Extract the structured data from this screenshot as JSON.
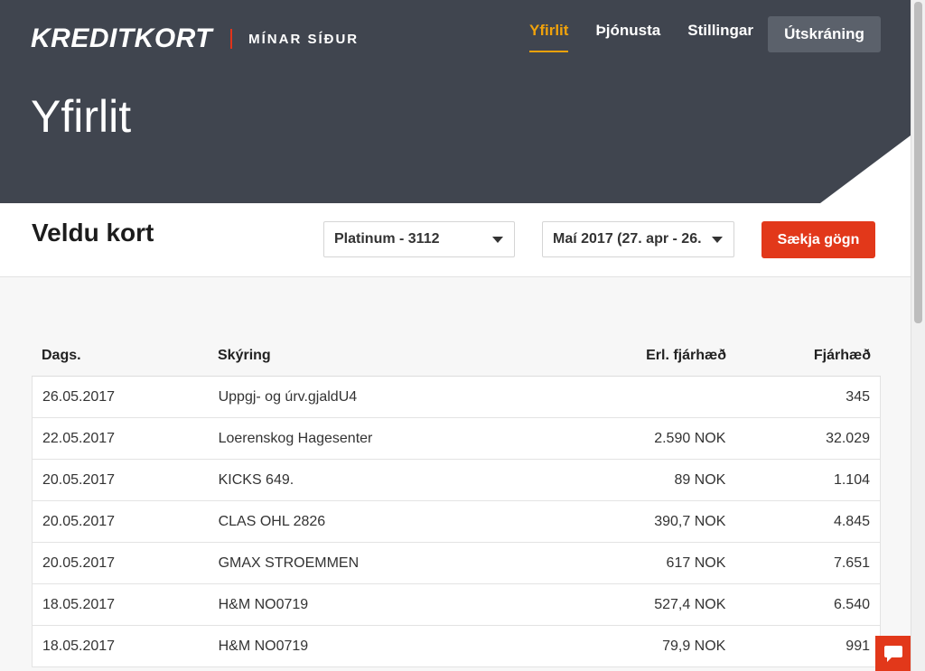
{
  "header": {
    "logo_text": "KREDITKORT",
    "logo_subtitle": "MÍNAR SÍÐUR",
    "nav": [
      {
        "label": "Yfirlit",
        "active": true
      },
      {
        "label": "Þjónusta",
        "active": false
      },
      {
        "label": "Stillingar",
        "active": false
      }
    ],
    "logout_label": "Útskráning",
    "page_title": "Yfirlit"
  },
  "filter": {
    "title": "Veldu kort",
    "card_select": "Platinum - 3112",
    "period_select": "Maí 2017 (27. apr - 26.",
    "fetch_label": "Sækja gögn"
  },
  "table": {
    "headers": {
      "date": "Dags.",
      "description": "Skýring",
      "foreign_amount": "Erl. fjárhæð",
      "amount": "Fjárhæð"
    },
    "rows": [
      {
        "date": "26.05.2017",
        "description": "Uppgj- og úrv.gjaldU4",
        "foreign_amount": "",
        "amount": "345"
      },
      {
        "date": "22.05.2017",
        "description": "Loerenskog Hagesenter",
        "foreign_amount": "2.590 NOK",
        "amount": "32.029"
      },
      {
        "date": "20.05.2017",
        "description": "KICKS 649.",
        "foreign_amount": "89 NOK",
        "amount": "1.104"
      },
      {
        "date": "20.05.2017",
        "description": "CLAS OHL 2826",
        "foreign_amount": "390,7 NOK",
        "amount": "4.845"
      },
      {
        "date": "20.05.2017",
        "description": "GMAX STROEMMEN",
        "foreign_amount": "617 NOK",
        "amount": "7.651"
      },
      {
        "date": "18.05.2017",
        "description": "H&M NO0719",
        "foreign_amount": "527,4 NOK",
        "amount": "6.540"
      },
      {
        "date": "18.05.2017",
        "description": "H&M NO0719",
        "foreign_amount": "79,9 NOK",
        "amount": "991"
      }
    ]
  },
  "colors": {
    "header_bg": "#40454f",
    "accent_orange": "#f0a20b",
    "brand_red": "#e2381a"
  },
  "icons": {
    "chat": "chat-bubble-icon",
    "dropdown": "caret-down-icon"
  }
}
